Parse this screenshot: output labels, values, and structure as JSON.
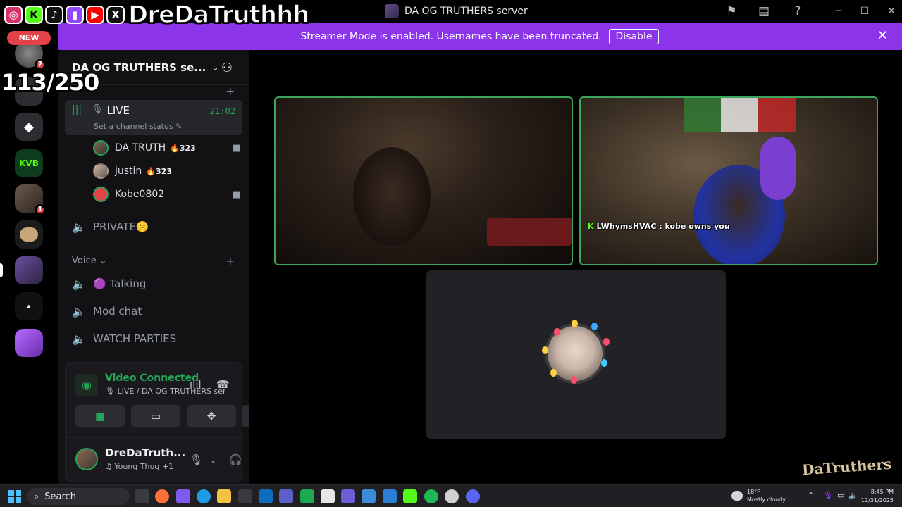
{
  "window": {
    "title": "DA OG TRUTHERS server"
  },
  "overlay": {
    "channel_name": "DreDaTruthhh",
    "counter": "113/250",
    "new_label": "NEW"
  },
  "streamer_mode": {
    "message": "Streamer Mode is enabled. Usernames have been truncated.",
    "disable_label": "Disable"
  },
  "rail": {
    "servers": [
      {
        "name": "server-1",
        "badge": "7"
      },
      {
        "name": "server-2",
        "badge": ""
      },
      {
        "name": "server-3",
        "badge": ""
      },
      {
        "name": "server-kvb",
        "label": "KVB",
        "badge": ""
      },
      {
        "name": "server-5",
        "badge": "1"
      },
      {
        "name": "server-6",
        "badge": ""
      },
      {
        "name": "server-7",
        "badge": ""
      },
      {
        "name": "server-8",
        "badge": ""
      },
      {
        "name": "server-9",
        "badge": ""
      }
    ]
  },
  "sidebar": {
    "server_name": "DA OG TRUTHERS se...",
    "live_channel": {
      "name": "LIVE",
      "time": "21:02",
      "status": "Set a channel status"
    },
    "members": [
      {
        "name": "DA TRUTH",
        "streak": "323",
        "camera": true
      },
      {
        "name": "justin",
        "streak": "323",
        "camera": false
      },
      {
        "name": "Kobe0802",
        "streak": "",
        "camera": true
      }
    ],
    "private_channel": "PRIVATE🤫",
    "voice_category": "Voice",
    "voice_channels": [
      "🟣 Talking",
      "Mod chat",
      "WATCH PARTIES"
    ]
  },
  "voice_panel": {
    "title": "Video Connected",
    "subtitle": "LIVE / DA OG TRUTHERS ser...",
    "user_name": "DreDaTruth...",
    "user_activity": "Young Thug +1"
  },
  "stage": {
    "chat_user": "LWhymsHVAC",
    "chat_message": ": kobe owns you",
    "watermark": "DaTruthers"
  },
  "taskbar": {
    "search_placeholder": "Search",
    "weather_temp": "18°F",
    "weather_desc": "Mostly cloudy",
    "time": "8:45 PM",
    "date": "12/31/2025"
  },
  "colors": {
    "streamer_bar": "#8b34e9",
    "speaking_green": "#3ba55d",
    "danger_red": "#e34248"
  }
}
